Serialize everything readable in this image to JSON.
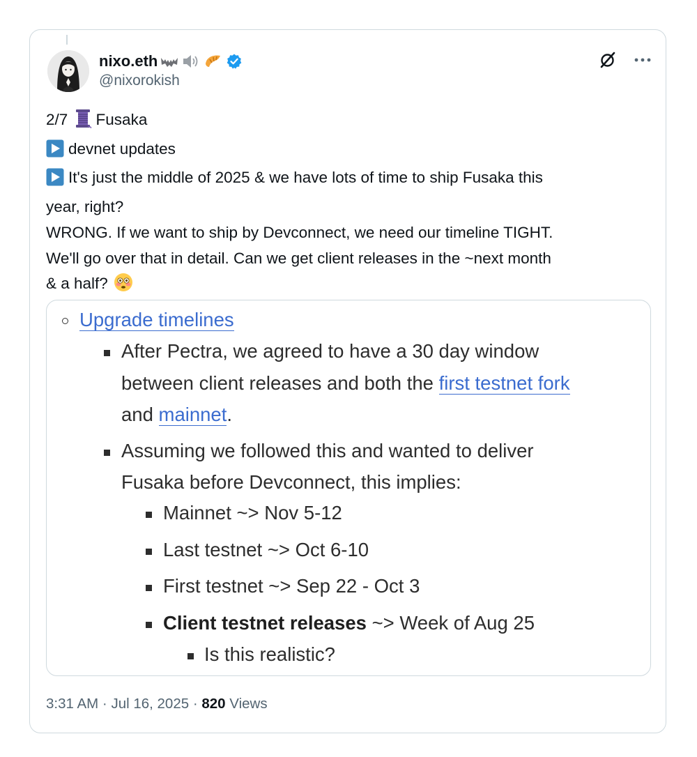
{
  "author": {
    "display_name": "nixo.eth",
    "name_emojis": [
      "bat-icon",
      "speaker-icon",
      "croissant-icon"
    ],
    "verified": true,
    "handle": "@nixorokish"
  },
  "tweet": {
    "lines": [
      {
        "prefix_icon": null,
        "text_a": "2/7",
        "icon_mid": "thread-spool-icon",
        "text_b": "Fusaka"
      },
      {
        "prefix_icon": "play-button-icon",
        "text": "devnet updates"
      },
      {
        "prefix_icon": "play-button-icon",
        "text": "It's just the middle of 2025 & we have lots of time to ship Fusaka this"
      },
      {
        "prefix_icon": null,
        "text": "year, right?"
      },
      {
        "prefix_icon": null,
        "text": "WRONG. If we want to ship by Devconnect, we need our timeline TIGHT."
      },
      {
        "prefix_icon": null,
        "text": "We'll go over that in detail. Can we get client releases in the ~next month"
      },
      {
        "prefix_icon": null,
        "text": "& a half?",
        "suffix_icon": "flushed-face-icon"
      }
    ]
  },
  "media": {
    "heading_link": "Upgrade timelines",
    "item1": {
      "line1": "After Pectra, we agreed to have a 30 day window",
      "line2_pre": "between client releases and both the ",
      "line2_link": "first testnet fork",
      "line3_pre": "and ",
      "line3_link": "mainnet",
      "line3_post": "."
    },
    "item2": {
      "line1": "Assuming we followed this and wanted to deliver",
      "line2": "Fusaka before Devconnect, this implies:"
    },
    "subitems": [
      {
        "bold": "",
        "text": "Mainnet ~> Nov 5-12"
      },
      {
        "bold": "",
        "text": "Last testnet ~> Oct 6-10"
      },
      {
        "bold": "",
        "text": "First testnet ~> Sep 22 - Oct 3"
      },
      {
        "bold": "Client testnet releases",
        "text": " ~> Week of Aug 25"
      }
    ],
    "subsubitem": "Is this realistic?"
  },
  "meta": {
    "time": "3:31 AM",
    "sep1": " · ",
    "date": "Jul 16, 2025",
    "sep2": " · ",
    "views_count": "820",
    "views_label": " Views"
  },
  "colors": {
    "link": "#3b6ccf",
    "verified": "#1d9bf0",
    "play_button": "#3b88c3",
    "muted": "#536471",
    "border": "#cfd9de"
  }
}
